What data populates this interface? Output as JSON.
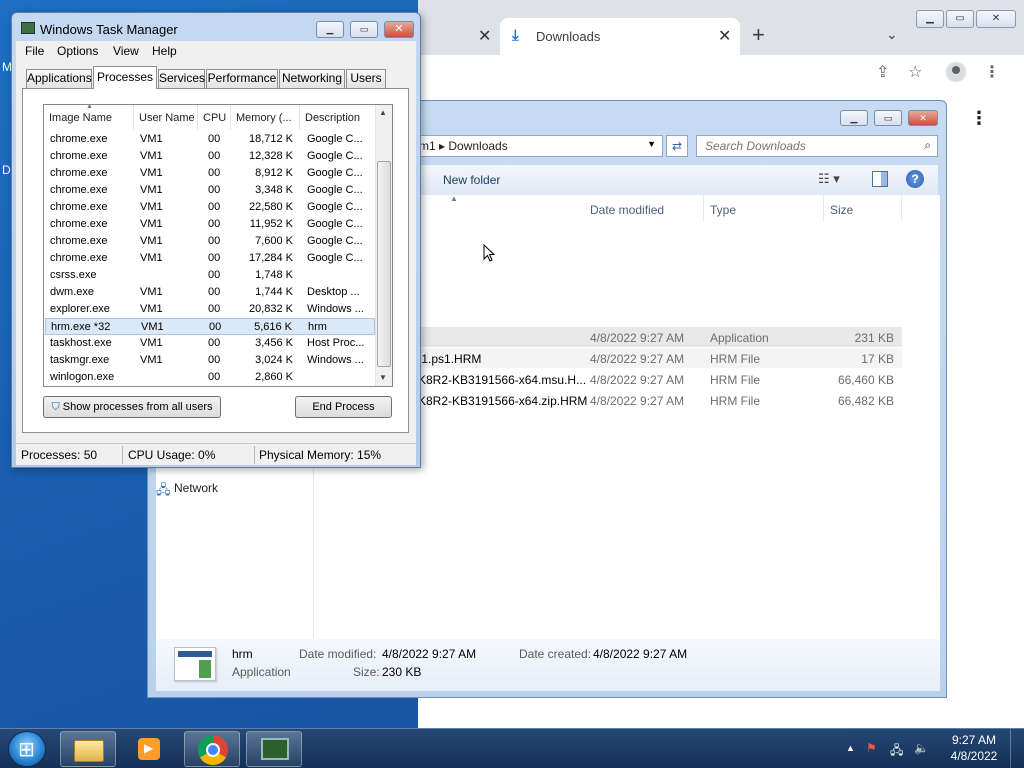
{
  "desktop": {
    "letter1": "M",
    "letter2": "D"
  },
  "chrome": {
    "tabs": [
      {
        "label": ""
      },
      {
        "label": "Downloads"
      }
    ],
    "new_tab": "+",
    "icons": [
      "share-icon",
      "star-icon",
      "profile-icon",
      "menu-icon"
    ]
  },
  "explorer": {
    "breadcrumb": "m1 ▸ Downloads",
    "search_placeholder": "Search Downloads",
    "new_folder": "New folder",
    "columns": [
      "Date modified",
      "Type",
      "Size"
    ],
    "files": [
      {
        "name": "",
        "date": "4/8/2022 9:27 AM",
        "type": "Application",
        "size": "231 KB"
      },
      {
        "name": ".1.ps1.HRM",
        "date": "4/8/2022 9:27 AM",
        "type": "HRM File",
        "size": "17 KB"
      },
      {
        "name": "K8R2-KB3191566-x64.msu.H...",
        "date": "4/8/2022 9:27 AM",
        "type": "HRM File",
        "size": "66,460 KB"
      },
      {
        "name": "K8R2-KB3191566-x64.zip.HRM",
        "date": "4/8/2022 9:27 AM",
        "type": "HRM File",
        "size": "66,482 KB"
      }
    ],
    "nav_network": "Network",
    "details": {
      "name": "hrm",
      "kind": "Application",
      "date_modified_label": "Date modified:",
      "date_modified": "4/8/2022 9:27 AM",
      "size_label": "Size:",
      "size": "230 KB",
      "date_created_label": "Date created:",
      "date_created": "4/8/2022 9:27 AM"
    }
  },
  "taskmgr": {
    "title": "Windows Task Manager",
    "menu": [
      "File",
      "Options",
      "View",
      "Help"
    ],
    "tabs": [
      "Applications",
      "Processes",
      "Services",
      "Performance",
      "Networking",
      "Users"
    ],
    "active_tab": "Processes",
    "columns": [
      "Image Name",
      "User Name",
      "CPU",
      "Memory (...",
      "Description"
    ],
    "rows": [
      {
        "image": "chrome.exe",
        "user": "VM1",
        "cpu": "00",
        "mem": "18,712 K",
        "desc": "Google C..."
      },
      {
        "image": "chrome.exe",
        "user": "VM1",
        "cpu": "00",
        "mem": "12,328 K",
        "desc": "Google C..."
      },
      {
        "image": "chrome.exe",
        "user": "VM1",
        "cpu": "00",
        "mem": "8,912 K",
        "desc": "Google C..."
      },
      {
        "image": "chrome.exe",
        "user": "VM1",
        "cpu": "00",
        "mem": "3,348 K",
        "desc": "Google C..."
      },
      {
        "image": "chrome.exe",
        "user": "VM1",
        "cpu": "00",
        "mem": "22,580 K",
        "desc": "Google C..."
      },
      {
        "image": "chrome.exe",
        "user": "VM1",
        "cpu": "00",
        "mem": "11,952 K",
        "desc": "Google C..."
      },
      {
        "image": "chrome.exe",
        "user": "VM1",
        "cpu": "00",
        "mem": "7,600 K",
        "desc": "Google C..."
      },
      {
        "image": "chrome.exe",
        "user": "VM1",
        "cpu": "00",
        "mem": "17,284 K",
        "desc": "Google C..."
      },
      {
        "image": "csrss.exe",
        "user": "",
        "cpu": "00",
        "mem": "1,748 K",
        "desc": ""
      },
      {
        "image": "dwm.exe",
        "user": "VM1",
        "cpu": "00",
        "mem": "1,744 K",
        "desc": "Desktop ..."
      },
      {
        "image": "explorer.exe",
        "user": "VM1",
        "cpu": "00",
        "mem": "20,832 K",
        "desc": "Windows ..."
      },
      {
        "image": "hrm.exe *32",
        "user": "VM1",
        "cpu": "00",
        "mem": "5,616 K",
        "desc": "hrm"
      },
      {
        "image": "taskhost.exe",
        "user": "VM1",
        "cpu": "00",
        "mem": "3,456 K",
        "desc": "Host Proc..."
      },
      {
        "image": "taskmgr.exe",
        "user": "VM1",
        "cpu": "00",
        "mem": "3,024 K",
        "desc": "Windows ..."
      },
      {
        "image": "winlogon.exe",
        "user": "",
        "cpu": "00",
        "mem": "2,860 K",
        "desc": ""
      }
    ],
    "selected_row": "hrm.exe *32",
    "show_all_button": "Show processes from all users",
    "end_process_button": "End Process",
    "status": {
      "processes": "Processes: 50",
      "cpu": "CPU Usage: 0%",
      "memory": "Physical Memory: 15%"
    }
  },
  "taskbar": {
    "clock_time": "9:27 AM",
    "clock_date": "4/8/2022",
    "tray_chevron": "▲"
  }
}
